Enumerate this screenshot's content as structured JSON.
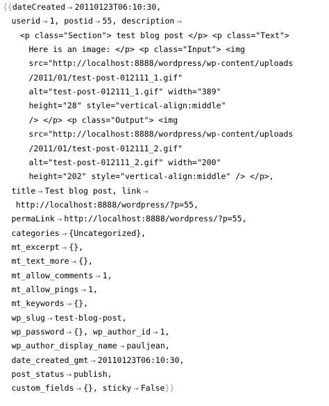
{
  "output": {
    "open_brace": "{{",
    "close_brace": "}}",
    "arrow_glyph": "→",
    "lines": [
      {
        "indent": 0,
        "open": true,
        "close": false,
        "segments": [
          {
            "k": "dateCreated",
            "v": "20110123T06:10:30,"
          }
        ]
      },
      {
        "indent": 1,
        "open": false,
        "close": false,
        "segments": [
          {
            "k": "userid",
            "v": "1, "
          },
          {
            "k": "postid",
            "v": "55, "
          },
          {
            "k": "description",
            "v": ""
          }
        ]
      },
      {
        "indent": 2,
        "open": false,
        "close": false,
        "segments": [
          {
            "k": "",
            "v": "<p class=\"Section\"> test blog post </p> <p class=\"Text\">"
          }
        ]
      },
      {
        "indent": 3,
        "open": false,
        "close": false,
        "segments": [
          {
            "k": "",
            "v": "Here is an image: </p> <p class=\"Input\"> <img"
          }
        ]
      },
      {
        "indent": 3,
        "open": false,
        "close": false,
        "segments": [
          {
            "k": "",
            "v": "src=\"http://localhost:8888/wordpress/wp-content/uploads"
          }
        ]
      },
      {
        "indent": 3,
        "open": false,
        "close": false,
        "segments": [
          {
            "k": "",
            "v": "/2011/01/test-post-012111_1.gif\""
          }
        ]
      },
      {
        "indent": 3,
        "open": false,
        "close": false,
        "segments": [
          {
            "k": "",
            "v": "alt=\"test-post-012111_1.gif\" width=\"389\""
          }
        ]
      },
      {
        "indent": 3,
        "open": false,
        "close": false,
        "segments": [
          {
            "k": "",
            "v": "height=\"28\" style=\"vertical-align:middle\""
          }
        ]
      },
      {
        "indent": 3,
        "open": false,
        "close": false,
        "segments": [
          {
            "k": "",
            "v": "/> </p> <p class=\"Output\"> <img"
          }
        ]
      },
      {
        "indent": 3,
        "open": false,
        "close": false,
        "segments": [
          {
            "k": "",
            "v": "src=\"http://localhost:8888/wordpress/wp-content/uploads"
          }
        ]
      },
      {
        "indent": 3,
        "open": false,
        "close": false,
        "segments": [
          {
            "k": "",
            "v": "/2011/01/test-post-012111_2.gif\""
          }
        ]
      },
      {
        "indent": 3,
        "open": false,
        "close": false,
        "segments": [
          {
            "k": "",
            "v": "alt=\"test-post-012111_2.gif\" width=\"200\""
          }
        ]
      },
      {
        "indent": 3,
        "open": false,
        "close": false,
        "segments": [
          {
            "k": "",
            "v": "height=\"202\" style=\"vertical-align:middle\" /> </p>,"
          }
        ]
      },
      {
        "indent": 1,
        "open": false,
        "close": false,
        "segments": [
          {
            "k": "title",
            "v": "Test blog post, "
          },
          {
            "k": "link",
            "v": ""
          }
        ]
      },
      {
        "indent": 1.5,
        "open": false,
        "close": false,
        "segments": [
          {
            "k": "",
            "v": "http://localhost:8888/wordpress/?p=55,"
          }
        ]
      },
      {
        "indent": 1,
        "open": false,
        "close": false,
        "segments": [
          {
            "k": "permaLink",
            "v": "http://localhost:8888/wordpress/?p=55,"
          }
        ]
      },
      {
        "indent": 1,
        "open": false,
        "close": false,
        "segments": [
          {
            "k": "categories",
            "v": "{Uncategorized},"
          }
        ]
      },
      {
        "indent": 1,
        "open": false,
        "close": false,
        "segments": [
          {
            "k": "mt_excerpt",
            "v": "{},"
          }
        ]
      },
      {
        "indent": 1,
        "open": false,
        "close": false,
        "segments": [
          {
            "k": "mt_text_more",
            "v": "{},"
          }
        ]
      },
      {
        "indent": 1,
        "open": false,
        "close": false,
        "segments": [
          {
            "k": "mt_allow_comments",
            "v": "1,"
          }
        ]
      },
      {
        "indent": 1,
        "open": false,
        "close": false,
        "segments": [
          {
            "k": "mt_allow_pings",
            "v": "1,"
          }
        ]
      },
      {
        "indent": 1,
        "open": false,
        "close": false,
        "segments": [
          {
            "k": "mt_keywords",
            "v": "{},"
          }
        ]
      },
      {
        "indent": 1,
        "open": false,
        "close": false,
        "segments": [
          {
            "k": "wp_slug",
            "v": "test-blog-post,"
          }
        ]
      },
      {
        "indent": 1,
        "open": false,
        "close": false,
        "segments": [
          {
            "k": "wp_password",
            "v": "{}, "
          },
          {
            "k": "wp_author_id",
            "v": "1,"
          }
        ]
      },
      {
        "indent": 1,
        "open": false,
        "close": false,
        "segments": [
          {
            "k": "wp_author_display_name",
            "v": "pauljean,"
          }
        ]
      },
      {
        "indent": 1,
        "open": false,
        "close": false,
        "segments": [
          {
            "k": "date_created_gmt",
            "v": "20110123T06:10:30,"
          }
        ]
      },
      {
        "indent": 1,
        "open": false,
        "close": false,
        "segments": [
          {
            "k": "post_status",
            "v": "publish,"
          }
        ]
      },
      {
        "indent": 1,
        "open": false,
        "close": true,
        "segments": [
          {
            "k": "custom_fields",
            "v": "{}, "
          },
          {
            "k": "sticky",
            "v": "False"
          }
        ]
      }
    ]
  }
}
